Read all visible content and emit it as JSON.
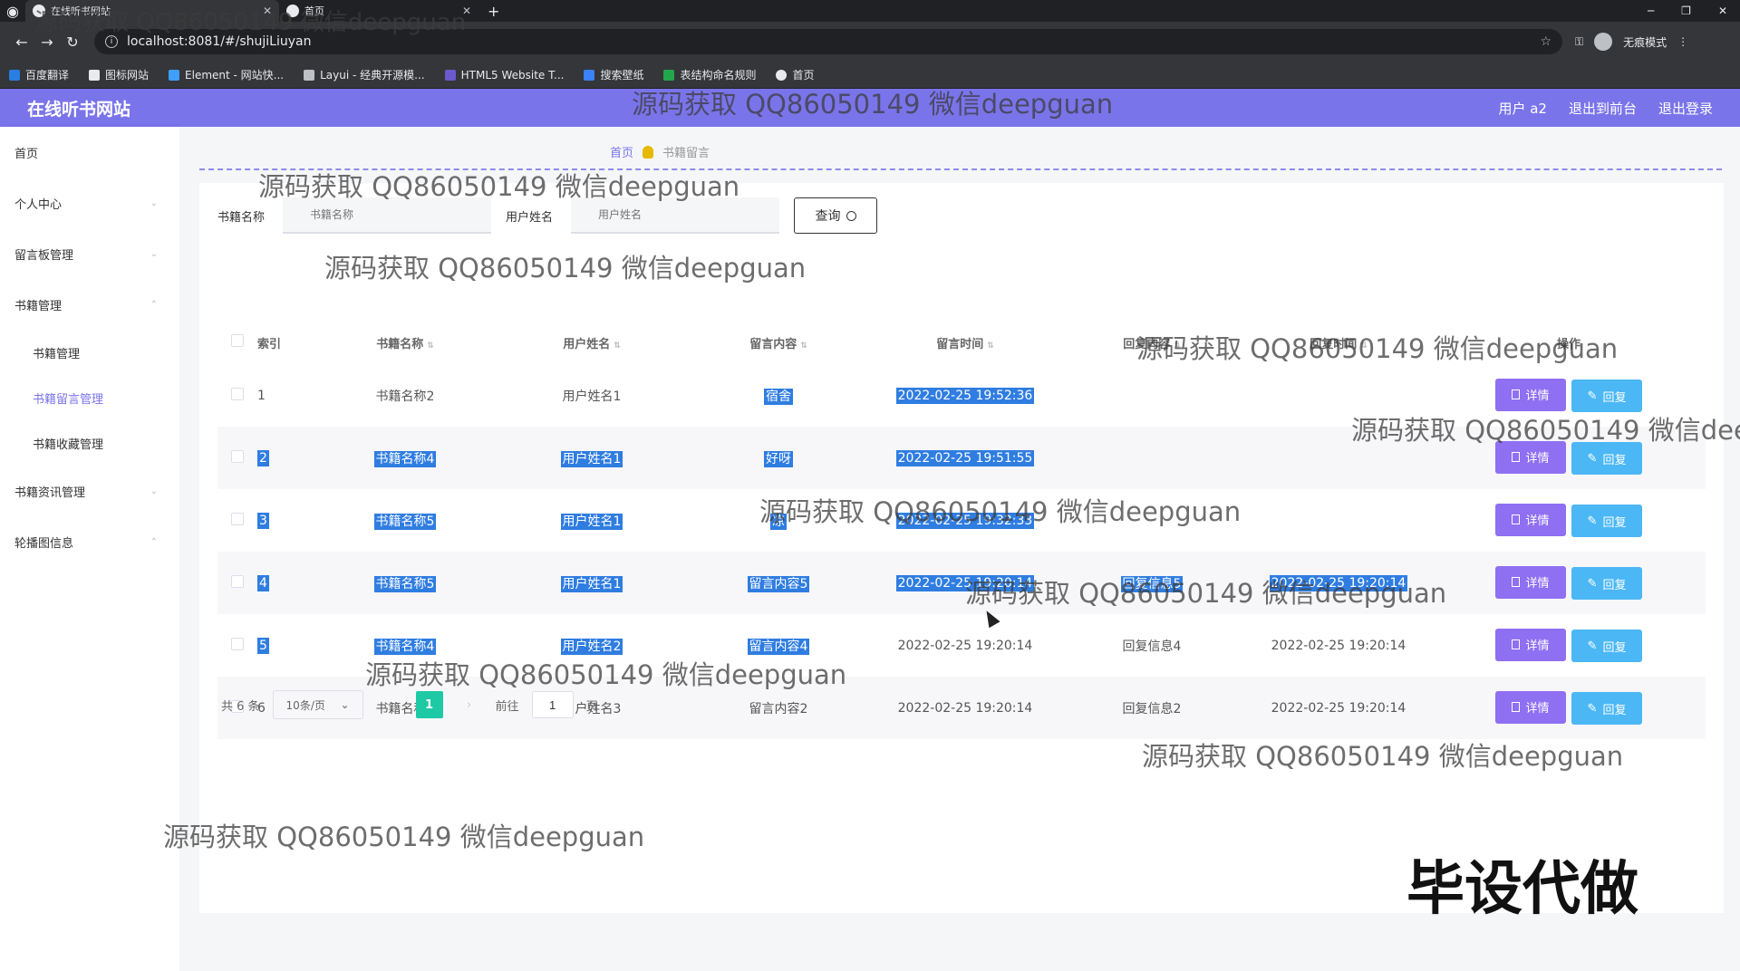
{
  "browser": {
    "tabs": [
      {
        "title": "在线听书网站",
        "active": true
      },
      {
        "title": "首页",
        "active": false
      }
    ],
    "url": "localhost:8081/#/shujiLiuyan",
    "profile_label": "无痕模式",
    "bookmarks": [
      "百度翻译",
      "图标网站",
      "Element - 网站快...",
      "Layui - 经典开源模...",
      "HTML5 Website T...",
      "搜索壁纸",
      "表结构命名规则",
      "首页"
    ]
  },
  "header": {
    "site_title": "在线听书网站",
    "user_label": "用户 a2",
    "back_to_front": "退出到前台",
    "logout": "退出登录"
  },
  "sidebar": {
    "items": [
      {
        "label": "首页"
      },
      {
        "label": "个人中心"
      },
      {
        "label": "留言板管理"
      },
      {
        "label": "书籍管理"
      },
      {
        "label": "书籍资讯管理"
      },
      {
        "label": "轮播图信息"
      }
    ],
    "sub_items": [
      {
        "label": "书籍管理"
      },
      {
        "label": "书籍留言管理",
        "active": true
      },
      {
        "label": "书籍收藏管理"
      }
    ]
  },
  "breadcrumb": {
    "home": "首页",
    "current": "书籍留言"
  },
  "search": {
    "book_label": "书籍名称",
    "book_placeholder": "书籍名称",
    "user_label": "用户姓名",
    "user_placeholder": "用户姓名",
    "query_button": "查询"
  },
  "table": {
    "headers": [
      "索引",
      "书籍名称",
      "用户姓名",
      "留言内容",
      "留言时间",
      "回复内容",
      "回复时间",
      "操作"
    ],
    "rows": [
      {
        "index": "1",
        "book": "书籍名称2",
        "user": "用户姓名1",
        "content": "宿舍",
        "time": "2022-02-25 19:52:36",
        "reply": "",
        "reply_time": ""
      },
      {
        "index": "2",
        "book": "书籍名称4",
        "user": "用户姓名1",
        "content": "好呀",
        "time": "2022-02-25 19:51:55",
        "reply": "",
        "reply_time": ""
      },
      {
        "index": "3",
        "book": "书籍名称5",
        "user": "用户姓名1",
        "content": "凉",
        "time": "2022-02-25 19:32:33",
        "reply": "",
        "reply_time": ""
      },
      {
        "index": "4",
        "book": "书籍名称5",
        "user": "用户姓名1",
        "content": "留言内容5",
        "time": "2022-02-25 19:20:14",
        "reply": "回复信息5",
        "reply_time": "2022-02-25 19:20:14"
      },
      {
        "index": "5",
        "book": "书籍名称4",
        "user": "用户姓名2",
        "content": "留言内容4",
        "time": "2022-02-25 19:20:14",
        "reply": "回复信息4",
        "reply_time": "2022-02-25 19:20:14"
      },
      {
        "index": "6",
        "book": "书籍名称2",
        "user": "用户姓名3",
        "content": "留言内容2",
        "time": "2022-02-25 19:20:14",
        "reply": "回复信息2",
        "reply_time": "2022-02-25 19:20:14"
      }
    ],
    "detail_label": "详情",
    "reply_label": "回复"
  },
  "pager": {
    "total": "共 6 条",
    "page_size": "10条/页",
    "current_page": "1",
    "goto_prefix": "前往",
    "goto_value": "1",
    "goto_suffix": "页"
  },
  "overlay": {
    "watermark": "源码获取 QQ86050149 微信deepguan",
    "stamp": "毕设代做"
  },
  "colors": {
    "header_bg": "#7a74ea",
    "detail_btn": "#8f6ff2",
    "reply_btn": "#4bb7f5",
    "page_active": "#1ec9a5",
    "selection": "#2f7de1"
  }
}
